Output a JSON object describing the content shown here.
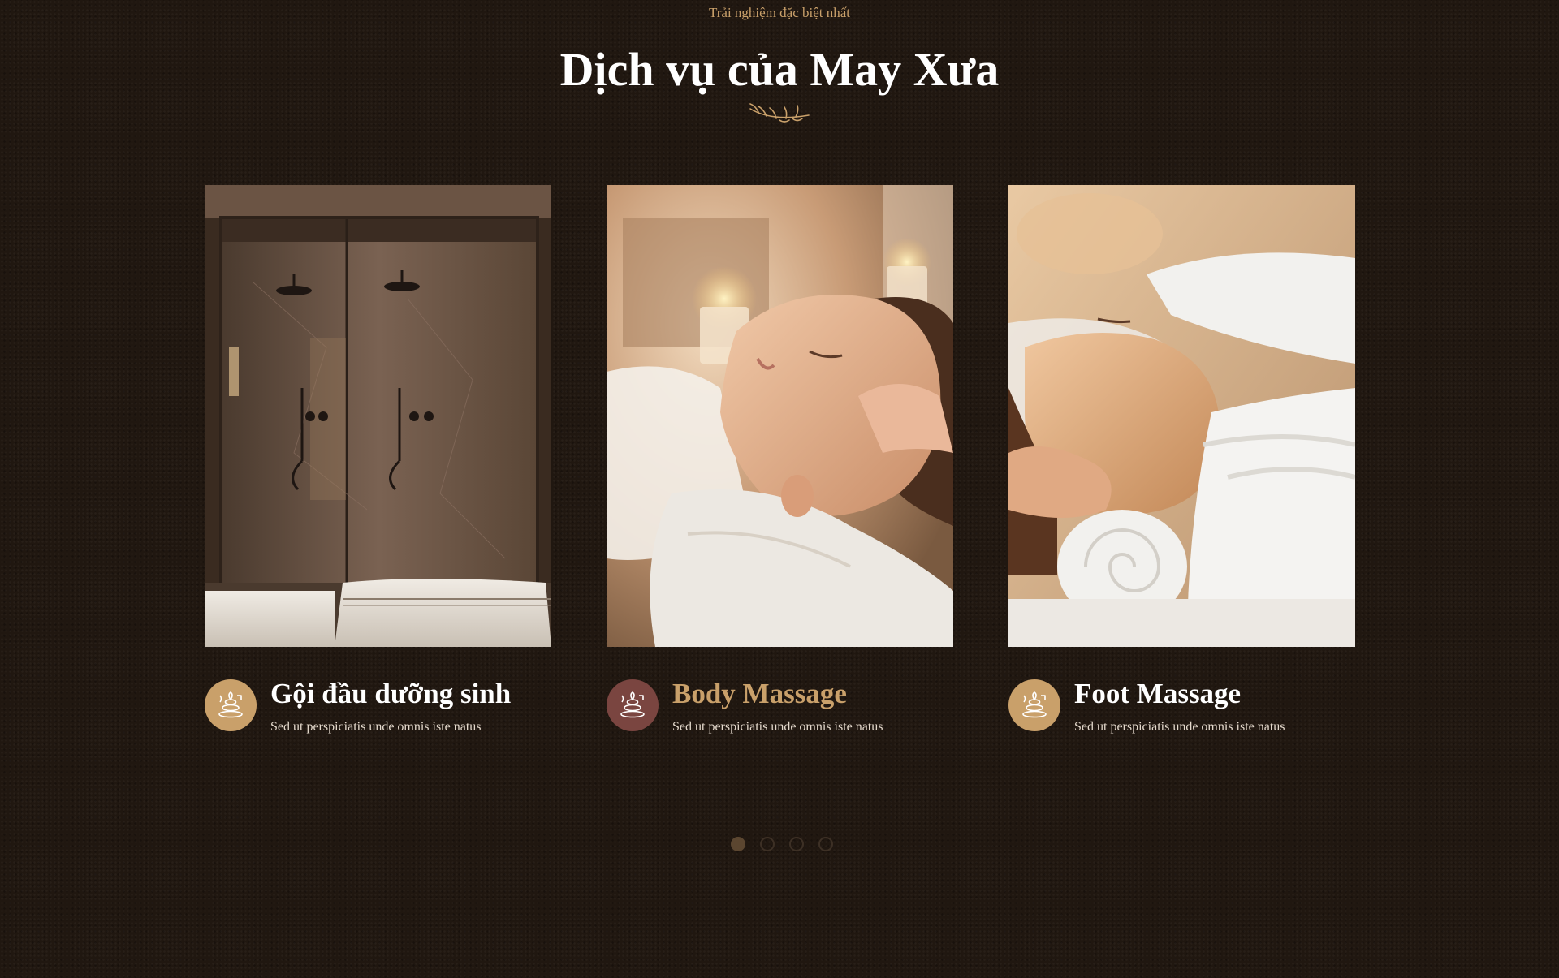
{
  "section": {
    "eyebrow": "Trải nghiệm đặc biệt nhất",
    "title": "Dịch vụ của May Xưa"
  },
  "colors": {
    "gold": "#c9a06a",
    "mauve": "#7a4540",
    "background": "#201710"
  },
  "services": [
    {
      "title": "Gội đầu dưỡng sinh",
      "description": "Sed ut perspiciatis unde omnis iste natus",
      "image": "spa-shower-room",
      "icon": "spa-stones-icon",
      "icon_color": "#c9a06a",
      "title_color": "#ffffff"
    },
    {
      "title": "Body Massage",
      "description": "Sed ut perspiciatis unde omnis iste natus",
      "image": "woman-head-massage",
      "icon": "spa-stones-icon",
      "icon_color": "#7a4540",
      "title_color": "#c9a06a"
    },
    {
      "title": "Foot Massage",
      "description": "Sed ut perspiciatis unde omnis iste natus",
      "image": "couple-massage-towels",
      "icon": "spa-stones-icon",
      "icon_color": "#c9a06a",
      "title_color": "#ffffff"
    }
  ],
  "pagination": {
    "total": 4,
    "active": 1
  }
}
